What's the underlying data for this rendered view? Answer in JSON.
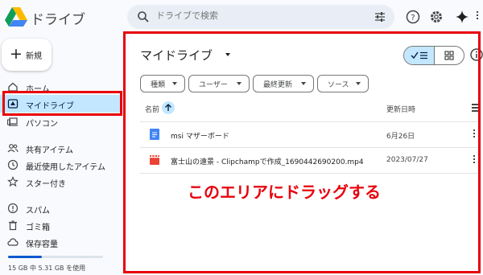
{
  "app": {
    "title": "ドライブ",
    "logo": "google-drive-logo"
  },
  "search": {
    "placeholder": "ドライブで検索",
    "icon": "search-icon",
    "filter_icon": "tune-icon"
  },
  "header_icons": [
    "help-icon",
    "settings-icon",
    "gemini-sparkle-icon"
  ],
  "sidebar": {
    "new_button": {
      "label": "新規",
      "icon": "plus-icon"
    },
    "items": [
      {
        "label": "ホーム",
        "icon": "home-icon"
      },
      {
        "label": "マイドライブ",
        "icon": "my-drive-icon",
        "active": true
      },
      {
        "label": "パソコン",
        "icon": "computer-icon"
      },
      {
        "label": "共有アイテム",
        "icon": "shared-people-icon"
      },
      {
        "label": "最近使用したアイテム",
        "icon": "clock-icon"
      },
      {
        "label": "スター付き",
        "icon": "star-icon"
      },
      {
        "label": "スパム",
        "icon": "spam-icon"
      },
      {
        "label": "ゴミ箱",
        "icon": "trash-icon"
      },
      {
        "label": "保存容量",
        "icon": "cloud-icon"
      }
    ],
    "storage": {
      "text": "15 GB 中 5.31 GB を使用",
      "used_fraction": 0.354
    }
  },
  "main": {
    "title": "マイドライブ",
    "filters": [
      {
        "label": "種類"
      },
      {
        "label": "ユーザー"
      },
      {
        "label": "最終更新"
      },
      {
        "label": "ソース"
      }
    ],
    "columns": {
      "name": "名前",
      "modified": "更新日時"
    },
    "files": [
      {
        "name": "msi マザーボード",
        "modified": "6月26日",
        "type": "google-doc"
      },
      {
        "name": "富士山の遠景 - Clipchampで作成_1690442690200.mp4",
        "modified": "2023/07/27",
        "type": "video"
      }
    ]
  },
  "annotation": {
    "text": "このエリアにドラッグする",
    "color": "#e8000b"
  },
  "colors": {
    "accent": "#0b57d0",
    "active_bg": "#c2e7ff",
    "annotation": "#e8000b"
  }
}
